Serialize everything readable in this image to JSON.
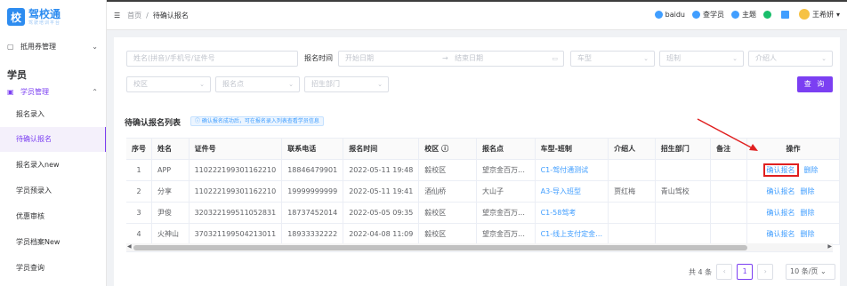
{
  "app": {
    "logo_badge": "校",
    "logo_name": "驾校通",
    "logo_sub": "驾驶培训平台"
  },
  "sidebar": {
    "coupon": "抵用券管理",
    "section": "学员",
    "student_mgmt": "学员管理",
    "items": [
      "报名录入",
      "待确认报名",
      "报名录入new",
      "学员预录入",
      "优惠审核",
      "学员档案New",
      "学员查询"
    ]
  },
  "header": {
    "breadcrumb": [
      "首页",
      "待确认报名"
    ],
    "links": [
      {
        "label": "baidu",
        "color": "#409eff"
      },
      {
        "label": "查学员",
        "color": "#409eff"
      },
      {
        "label": "主题",
        "color": "#409eff"
      },
      {
        "label": "",
        "color": "#19be6b"
      },
      {
        "label": "",
        "color": "#409eff"
      }
    ],
    "user": "王希妍"
  },
  "filters": {
    "name_placeholder": "姓名(拼音)/手机号/证件号",
    "time_label": "报名时间",
    "start_placeholder": "开始日期",
    "range_sep": "→",
    "end_placeholder": "结束日期",
    "car_type": "车型",
    "class_type": "班制",
    "referrer": "介绍人",
    "campus": "校区",
    "point": "报名点",
    "dept": "招生部门",
    "query": "查 询"
  },
  "list": {
    "title": "待确认报名列表",
    "tip": "ⓘ 确认报名成功后，可在报名录入列表查看学员信息"
  },
  "table": {
    "headers": [
      "序号",
      "姓名",
      "证件号",
      "联系电话",
      "报名时间",
      "校区 ⓘ",
      "报名点",
      "车型-班制",
      "介绍人",
      "招生部门",
      "备注",
      "操作"
    ],
    "rows": [
      [
        "1",
        "APP",
        "110222199301162210",
        "18846479901",
        "2022-05-11 19:48",
        "毅校区",
        "望京金百万…",
        "C1-驾付通测试",
        "",
        "",
        "",
        ""
      ],
      [
        "2",
        "分享",
        "110222199301162210",
        "19999999999",
        "2022-05-11 19:41",
        "酒仙桥",
        "大山子",
        "A3-导入班型",
        "贾红梅",
        "青山驾校",
        "",
        ""
      ],
      [
        "3",
        "尹俊",
        "320322199511052831",
        "18737452014",
        "2022-05-05 09:35",
        "毅校区",
        "望京金百万…",
        "C1-58驾考",
        "",
        "",
        "",
        ""
      ],
      [
        "4",
        "火神山",
        "370321199504213011",
        "18933332222",
        "2022-04-08 11:09",
        "毅校区",
        "望京金百万…",
        "C1-线上支付定金…",
        "",
        "",
        "",
        ""
      ]
    ],
    "confirm": "确认报名",
    "delete": "删除"
  },
  "pager": {
    "total": "共 4 条",
    "page": "1",
    "size": "10 条/页"
  }
}
